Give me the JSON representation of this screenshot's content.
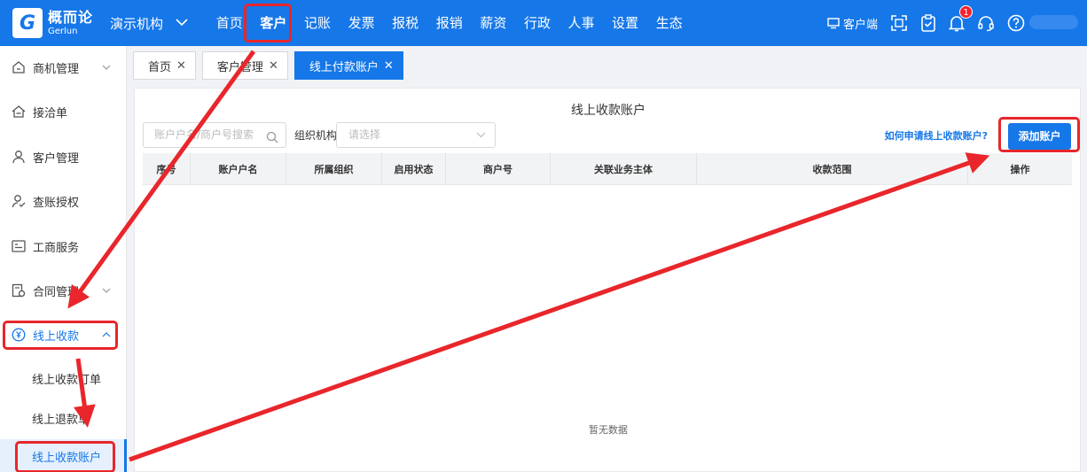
{
  "brand": {
    "mark": "G",
    "name_cn": "概而论",
    "name_en": "Gerlun"
  },
  "org": {
    "name": "演示机构"
  },
  "nav": [
    {
      "label": "首页"
    },
    {
      "label": "客户",
      "active": true
    },
    {
      "label": "记账"
    },
    {
      "label": "发票"
    },
    {
      "label": "报税"
    },
    {
      "label": "报销"
    },
    {
      "label": "薪资"
    },
    {
      "label": "行政"
    },
    {
      "label": "人事"
    },
    {
      "label": "设置"
    },
    {
      "label": "生态"
    }
  ],
  "tools": {
    "client_label": "客户端",
    "notification_count": "1"
  },
  "sidebar": {
    "items": [
      {
        "label": "商机管理",
        "icon": "opportunity-icon",
        "has_arrow": true
      },
      {
        "label": "接洽单",
        "icon": "contact-form-icon"
      },
      {
        "label": "客户管理",
        "icon": "customer-icon"
      },
      {
        "label": "查账授权",
        "icon": "audit-auth-icon"
      },
      {
        "label": "工商服务",
        "icon": "business-service-icon"
      },
      {
        "label": "合同管理",
        "icon": "contract-icon",
        "has_arrow": true
      },
      {
        "label": "线上收款",
        "icon": "online-payment-icon",
        "open": true
      }
    ],
    "sub_items": [
      {
        "label": "线上收款订单"
      },
      {
        "label": "线上退款单"
      },
      {
        "label": "线上收款账户",
        "selected": true
      }
    ]
  },
  "tabs": [
    {
      "label": "首页"
    },
    {
      "label": "客户管理"
    },
    {
      "label": "线上付款账户",
      "active": true
    }
  ],
  "main": {
    "title": "线上收款账户",
    "search_placeholder": "账户户名/商户号搜索",
    "org_label": "组织机构",
    "org_placeholder": "请选择",
    "help_link": "如何申请线上收款账户?",
    "add_button": "添加账户",
    "columns": [
      "序号",
      "账户户名",
      "所属组织",
      "启用状态",
      "商户号",
      "关联业务主体",
      "收款范围",
      "操作"
    ],
    "empty_text": "暂无数据"
  },
  "colors": {
    "brand_blue": "#1677e8",
    "annotation_red": "#e8262b"
  }
}
